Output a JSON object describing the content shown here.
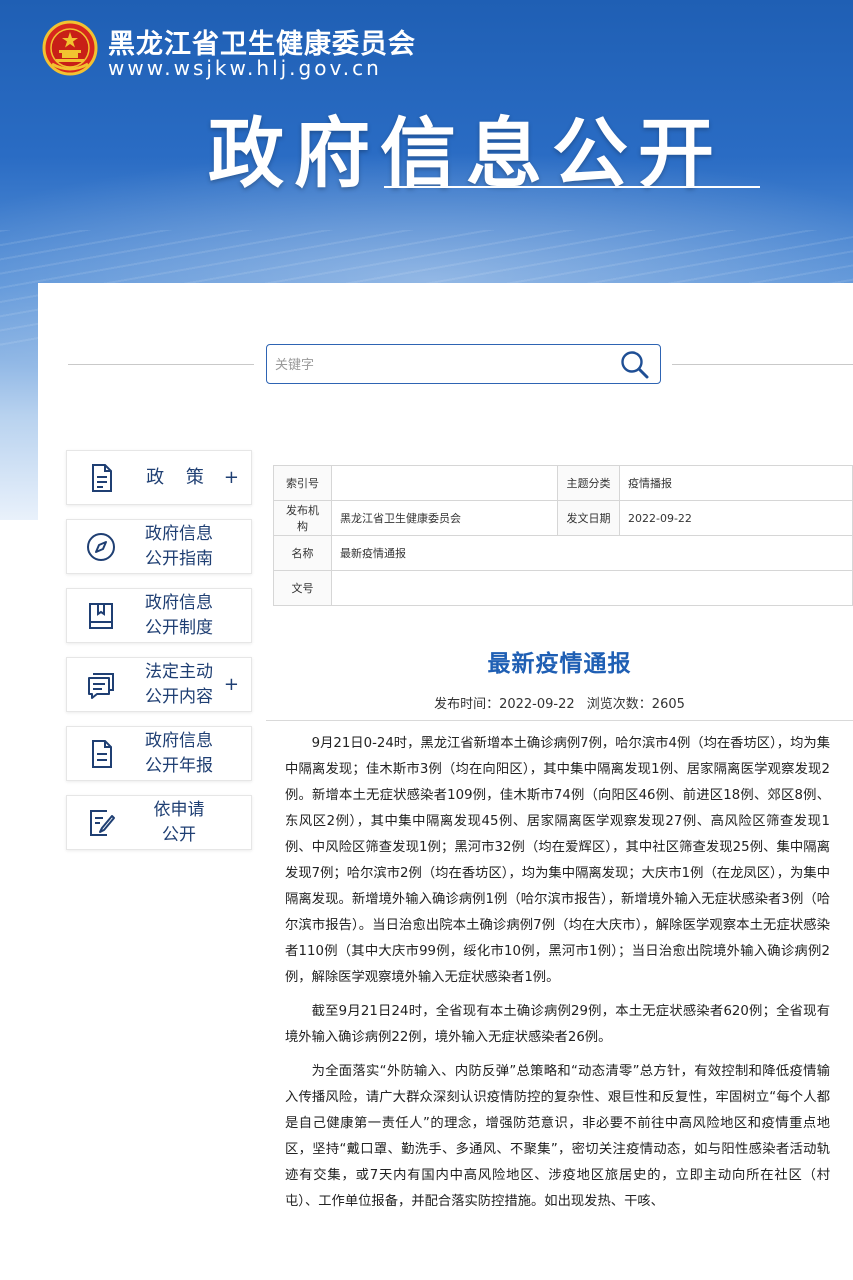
{
  "header": {
    "site_name": "黑龙江省卫生健康委员会",
    "site_url": "www.wsjkw.hlj.gov.cn",
    "section_title": "政府信息公开"
  },
  "search": {
    "placeholder": "关键字"
  },
  "sidebar": {
    "items": [
      {
        "label": "政 策",
        "icon": "document-icon",
        "has_plus": true,
        "plus": "+"
      },
      {
        "label": "政府信息\n公开指南",
        "icon": "compass-icon",
        "has_plus": false
      },
      {
        "label": "政府信息\n公开制度",
        "icon": "book-icon",
        "has_plus": false
      },
      {
        "label": "法定主动\n公开内容",
        "icon": "chat-list-icon",
        "has_plus": true,
        "plus": "+"
      },
      {
        "label": "政府信息\n公开年报",
        "icon": "report-icon",
        "has_plus": false
      },
      {
        "label": "依申请\n公开",
        "icon": "edit-form-icon",
        "has_plus": false
      }
    ]
  },
  "info_table": {
    "index_label": "索引号",
    "index_value": "",
    "topic_label": "主题分类",
    "topic_value": "疫情播报",
    "publisher_label": "发布机构",
    "publisher_value": "黑龙江省卫生健康委员会",
    "date_label": "发文日期",
    "date_value": "2022-09-22",
    "name_label": "名称",
    "name_value": "最新疫情通报",
    "docno_label": "文号",
    "docno_value": ""
  },
  "article": {
    "title": "最新疫情通报",
    "publish_label": "发布时间：2022-09-22",
    "views_label": "浏览次数：2605",
    "paragraphs": [
      "9月21日0-24时，黑龙江省新增本土确诊病例7例，哈尔滨市4例（均在香坊区），均为集中隔离发现；佳木斯市3例（均在向阳区），其中集中隔离发现1例、居家隔离医学观察发现2例。新增本土无症状感染者109例，佳木斯市74例（向阳区46例、前进区18例、郊区8例、东风区2例），其中集中隔离发现45例、居家隔离医学观察发现27例、高风险区筛查发现1例、中风险区筛查发现1例；黑河市32例（均在爱辉区），其中社区筛查发现25例、集中隔离发现7例；哈尔滨市2例（均在香坊区），均为集中隔离发现；大庆市1例（在龙凤区），为集中隔离发现。新增境外输入确诊病例1例（哈尔滨市报告），新增境外输入无症状感染者3例（哈尔滨市报告）。当日治愈出院本土确诊病例7例（均在大庆市），解除医学观察本土无症状感染者110例（其中大庆市99例，绥化市10例，黑河市1例）；当日治愈出院境外输入确诊病例2例，解除医学观察境外输入无症状感染者1例。",
      "截至9月21日24时，全省现有本土确诊病例29例，本土无症状感染者620例；全省现有境外输入确诊病例22例，境外输入无症状感染者26例。",
      "为全面落实“外防输入、内防反弹”总策略和“动态清零”总方针，有效控制和降低疫情输入传播风险，请广大群众深刻认识疫情防控的复杂性、艰巨性和反复性，牢固树立“每个人都是自己健康第一责任人”的理念，增强防范意识，非必要不前往中高风险地区和疫情重点地区，坚持“戴口罩、勤洗手、多通风、不聚集”，密切关注疫情动态，如与阳性感染者活动轨迹有交集，或7天内有国内中高风险地区、涉疫地区旅居史的，立即主动向所在社区（村屯）、工作单位报备，并配合落实防控措施。如出现发热、干咳、"
    ]
  },
  "colors": {
    "brand_blue": "#1f5fb4",
    "sidebar_text": "#1f3f73"
  }
}
